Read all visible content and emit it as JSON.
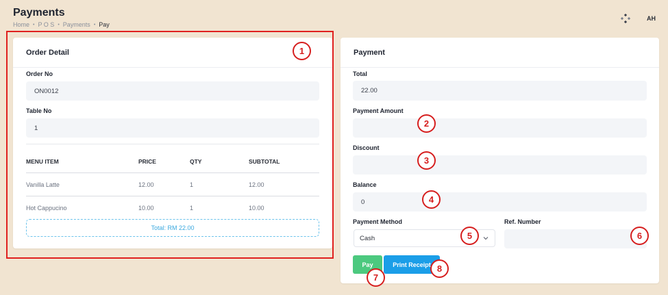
{
  "page": {
    "title": "Payments",
    "breadcrumb": [
      "Home",
      "P O S",
      "Payments",
      "Pay"
    ],
    "avatar_initials": "AH"
  },
  "order_detail": {
    "title": "Order Detail",
    "order_no_label": "Order No",
    "order_no_value": "ON0012",
    "table_no_label": "Table No",
    "table_no_value": "1",
    "columns": [
      "MENU ITEM",
      "PRICE",
      "QTY",
      "SUBTOTAL"
    ],
    "rows": [
      {
        "item": "Vanilla Latte",
        "price": "12.00",
        "qty": "1",
        "subtotal": "12.00"
      },
      {
        "item": "Hot Cappucino",
        "price": "10.00",
        "qty": "1",
        "subtotal": "10.00"
      }
    ],
    "total": "Total: RM 22.00"
  },
  "payment": {
    "title": "Payment",
    "total_label": "Total",
    "total_value": "22.00",
    "amount_label": "Payment Amount",
    "amount_value": "",
    "discount_label": "Discount",
    "discount_value": "",
    "balance_label": "Balance",
    "balance_value": "0",
    "method_label": "Payment Method",
    "method_value": "Cash",
    "ref_label": "Ref. Number",
    "ref_value": "",
    "pay_button": "Pay",
    "print_button": "Print Receipt"
  },
  "markers": [
    "1",
    "2",
    "3",
    "4",
    "5",
    "6",
    "7",
    "8"
  ],
  "colors": {
    "background": "#f1e4d1",
    "highlight_frame": "#e0201e",
    "pay_button": "#4cc97f",
    "print_button": "#1b9ee8",
    "total_text": "#3aa8df",
    "marker": "#d61e1e"
  },
  "icons": {
    "header_settings": "diamond-dots-icon",
    "select_chevron": "chevron-down-icon"
  }
}
